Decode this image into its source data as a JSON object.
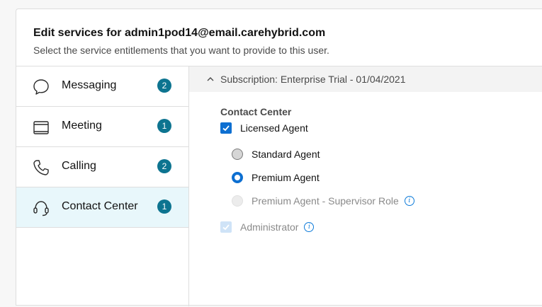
{
  "header": {
    "title": "Edit services for admin1pod14@email.carehybrid.com",
    "subtitle": "Select the service entitlements that you want to provide to this user."
  },
  "sidebar": {
    "items": [
      {
        "label": "Messaging",
        "badge": "2",
        "icon": "chat-bubble-icon",
        "selected": false
      },
      {
        "label": "Meeting",
        "badge": "1",
        "icon": "calendar-icon",
        "selected": false
      },
      {
        "label": "Calling",
        "badge": "2",
        "icon": "phone-icon",
        "selected": false
      },
      {
        "label": "Contact Center",
        "badge": "1",
        "icon": "headset-icon",
        "selected": true
      }
    ]
  },
  "subscription": {
    "label": "Subscription: Enterprise Trial - 01/04/2021",
    "expanded": true
  },
  "contact_center": {
    "section_title": "Contact Center",
    "licensed_agent": {
      "label": "Licensed Agent",
      "checked": true
    },
    "options": [
      {
        "label": "Standard Agent",
        "state": "unselected"
      },
      {
        "label": "Premium Agent",
        "state": "selected"
      },
      {
        "label": "Premium Agent - Supervisor Role",
        "state": "disabled",
        "info": true
      }
    ],
    "administrator": {
      "label": "Administrator",
      "checked": true,
      "disabled": true,
      "info": true
    }
  },
  "colors": {
    "accent": "#0d6fd1",
    "badge": "#0d7490",
    "selected_row": "#e8f7fb"
  }
}
